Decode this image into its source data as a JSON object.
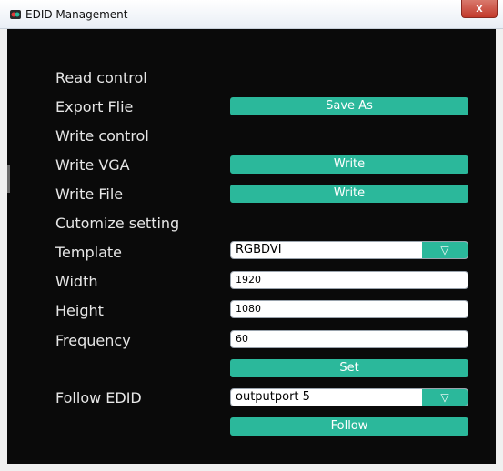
{
  "window": {
    "title": "EDID Management",
    "close_glyph": "x",
    "app_icon": "app-logo-icon"
  },
  "labels": {
    "read_control": "Read control",
    "export_file": "Export Flie",
    "write_control": "Write control",
    "write_vga": "Write VGA",
    "write_file": "Write File",
    "customize": "Cutomize setting",
    "template": "Template",
    "width": "Width",
    "height": "Height",
    "frequency": "Frequency",
    "follow_edid": "Follow EDID"
  },
  "buttons": {
    "save_as": "Save As",
    "write_vga": "Write",
    "write_file": "Write",
    "set": "Set",
    "follow": "Follow"
  },
  "fields": {
    "template": "RGBDVI",
    "width": "1920",
    "height": "1080",
    "frequency": "60",
    "follow_edid": "outputport 5"
  },
  "dropdown_glyph": "▽",
  "colors": {
    "accent": "#2bb89b",
    "background": "#0a0a0a",
    "label_text": "#e6e6e6"
  }
}
